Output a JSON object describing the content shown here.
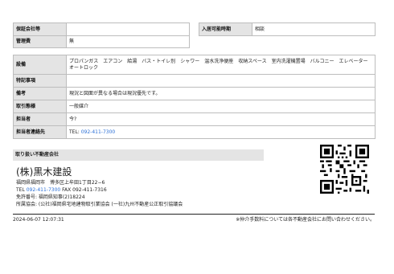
{
  "top_table": {
    "guarantor_label": "保証会社等",
    "guarantor_value": "",
    "move_in_label": "入居可能時期",
    "move_in_value": "相談",
    "mgmt_label": "管理費",
    "mgmt_value": "無"
  },
  "detail_table": {
    "equipment_label": "設備",
    "equipment_value": "プロパンガス　エアコン　給湯　バス・トイレ別　シャワー　温水洗浄便座　収納スペース　室内洗濯機置場　バルコニー　エレベーター　オートロック",
    "special_label": "特記事項",
    "special_value": "",
    "remarks_label": "備考",
    "remarks_value": "現況と図面が異なる場合は現況優先です。",
    "transaction_label": "取引態様",
    "transaction_value": "一般媒介",
    "staff_label": "担当者",
    "staff_value": "今?",
    "contact_label": "担当者連絡先",
    "contact_prefix": "TEL: ",
    "contact_phone": "092-411-7300"
  },
  "agency": {
    "header": "取り扱い不動産会社",
    "name": "(株)黒木建設",
    "address": "福岡県福岡市　博多区上牟田1丁目22−6",
    "tel_prefix": "TEL ",
    "tel": "092-411-7300",
    "fax": " FAX 092-411-7316",
    "license": "免許番号: 福岡県知事(2)18224",
    "association": "所属協会: (公社)福岡県宅地建物取引業協会 (一社)九州不動産公正取引協議会"
  },
  "footer": {
    "timestamp": "2024-06-07 12:07:31",
    "notice": "※仲介手数料については各不動産会社にお問い合わせください。"
  }
}
